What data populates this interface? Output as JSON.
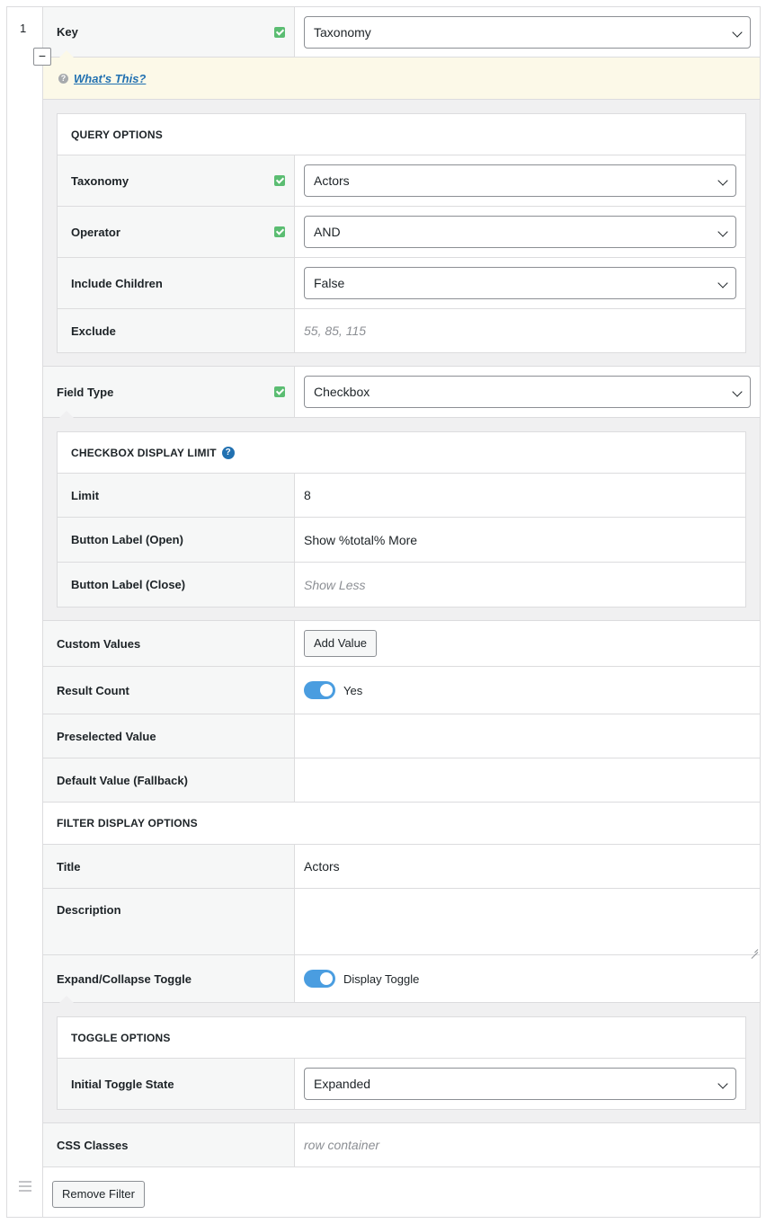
{
  "row_number": "1",
  "key": {
    "label": "Key",
    "value": "Taxonomy"
  },
  "notice": {
    "link": "What's This?"
  },
  "query_options": {
    "heading": "QUERY OPTIONS",
    "taxonomy": {
      "label": "Taxonomy",
      "value": "Actors"
    },
    "operator": {
      "label": "Operator",
      "value": "AND"
    },
    "include_children": {
      "label": "Include Children",
      "value": "False"
    },
    "exclude": {
      "label": "Exclude",
      "placeholder": "55, 85, 115"
    }
  },
  "field_type": {
    "label": "Field Type",
    "value": "Checkbox"
  },
  "checkbox_limit": {
    "heading": "CHECKBOX DISPLAY LIMIT",
    "limit": {
      "label": "Limit",
      "value": "8"
    },
    "open_label": {
      "label": "Button Label (Open)",
      "value": "Show %total% More"
    },
    "close_label": {
      "label": "Button Label (Close)",
      "placeholder": "Show Less"
    }
  },
  "custom_values": {
    "label": "Custom Values",
    "button": "Add Value"
  },
  "result_count": {
    "label": "Result Count",
    "toggle_text": "Yes"
  },
  "preselected": {
    "label": "Preselected Value"
  },
  "default_value": {
    "label": "Default Value (Fallback)"
  },
  "filter_display": {
    "heading": "FILTER DISPLAY OPTIONS",
    "title": {
      "label": "Title",
      "value": "Actors"
    },
    "description": {
      "label": "Description"
    },
    "expand": {
      "label": "Expand/Collapse Toggle",
      "toggle_text": "Display Toggle"
    }
  },
  "toggle_options": {
    "heading": "TOGGLE OPTIONS",
    "initial_state": {
      "label": "Initial Toggle State",
      "value": "Expanded"
    }
  },
  "css_classes": {
    "label": "CSS Classes",
    "placeholder": "row container"
  },
  "footer": {
    "remove_button": "Remove Filter"
  },
  "colors": {
    "check": "#5bbd72",
    "toggle": "#4a9de0",
    "notice_bg": "#fcf9e8",
    "link": "#2271b1"
  },
  "icons": [
    "check-icon",
    "question-icon",
    "help-icon",
    "chevron-down-icon",
    "collapse-icon",
    "drag-handle-icon"
  ]
}
